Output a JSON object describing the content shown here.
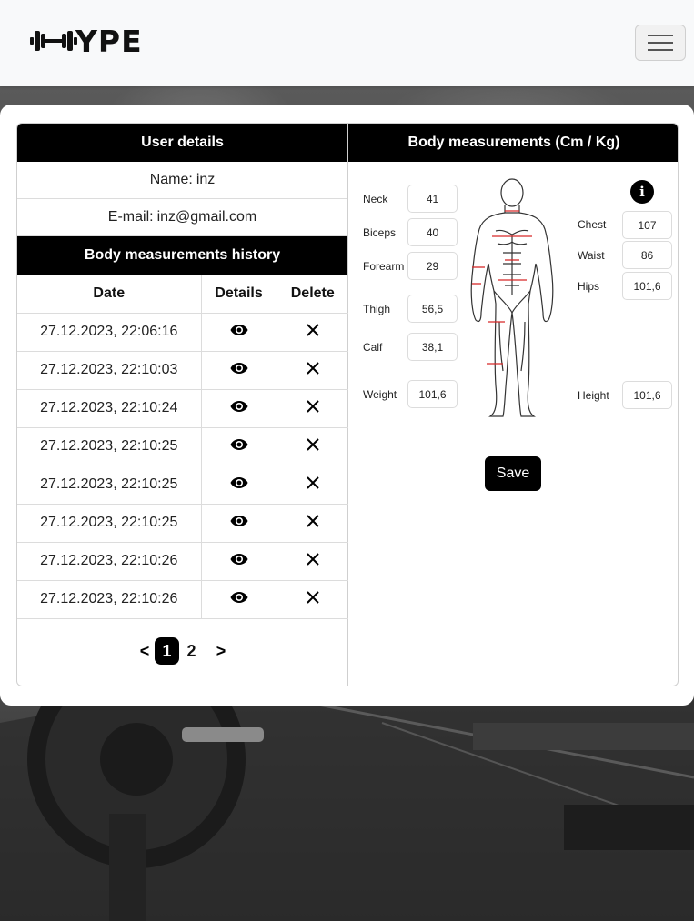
{
  "brand": {
    "logo_text": "YPE",
    "logo_icon": "dumbbell-icon"
  },
  "nav": {
    "menu_icon": "hamburger-icon"
  },
  "user_details": {
    "title": "User details",
    "name_label": "Name:",
    "name_value": "inz",
    "email_label": "E-mail:",
    "email_value": "inz@gmail.com"
  },
  "history": {
    "title": "Body measurements history",
    "columns": [
      "Date",
      "Details",
      "Delete"
    ],
    "rows": [
      {
        "date": "27.12.2023, 22:06:16"
      },
      {
        "date": "27.12.2023, 22:10:03"
      },
      {
        "date": "27.12.2023, 22:10:24"
      },
      {
        "date": "27.12.2023, 22:10:25"
      },
      {
        "date": "27.12.2023, 22:10:25"
      },
      {
        "date": "27.12.2023, 22:10:25"
      },
      {
        "date": "27.12.2023, 22:10:26"
      },
      {
        "date": "27.12.2023, 22:10:26"
      }
    ],
    "details_icon": "eye-icon",
    "delete_icon": "close-icon"
  },
  "pagination": {
    "prev": "<",
    "pages": [
      "1",
      "2"
    ],
    "active": "1",
    "next": ">"
  },
  "measurements": {
    "title": "Body measurements (Cm / Kg)",
    "neck": {
      "label": "Neck",
      "value": "41"
    },
    "biceps": {
      "label": "Biceps",
      "value": "40"
    },
    "forearm": {
      "label": "Forearm",
      "value": "29"
    },
    "thigh": {
      "label": "Thigh",
      "value": "56,5"
    },
    "calf": {
      "label": "Calf",
      "value": "38,1"
    },
    "weight": {
      "label": "Weight",
      "value": "101,6"
    },
    "chest": {
      "label": "Chest",
      "value": "107"
    },
    "waist": {
      "label": "Waist",
      "value": "86"
    },
    "hips": {
      "label": "Hips",
      "value": "101,6"
    },
    "height": {
      "label": "Height",
      "value": "101,6"
    },
    "info_icon": "info-icon",
    "save_label": "Save"
  },
  "colors": {
    "header_bg": "#000000",
    "measure_line": "#d62828",
    "navbar_bg": "#f8f9fa"
  }
}
